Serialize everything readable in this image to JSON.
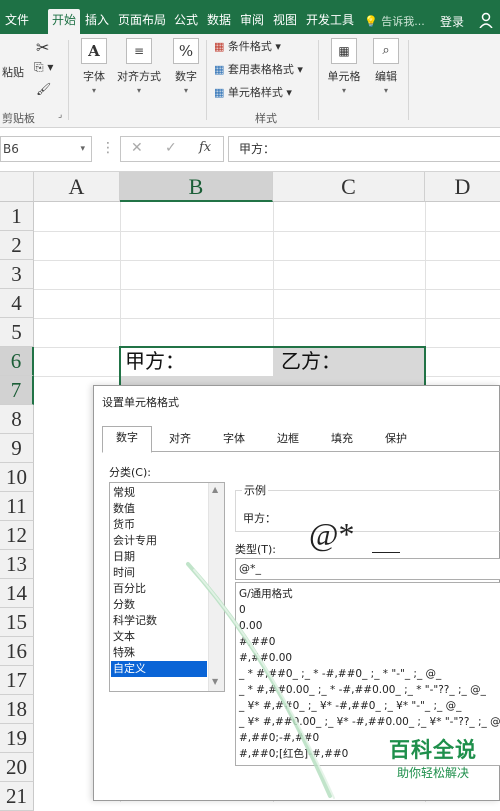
{
  "ribbon_tabs": [
    "文件",
    "开始",
    "插入",
    "页面布局",
    "公式",
    "数据",
    "审阅",
    "视图",
    "开发工具"
  ],
  "tellme": "告诉我...",
  "login": "登录",
  "clipboard": {
    "paste": "粘贴",
    "group": "剪贴板"
  },
  "ribbon_buttons": {
    "font": "字体",
    "align": "对齐方式",
    "number": "数字",
    "conditional": "条件格式",
    "table": "套用表格格式",
    "cellstyle": "单元格样式",
    "styles_group": "样式",
    "cells": "单元格",
    "editing": "编辑"
  },
  "formula_bar": {
    "namebox": "B6",
    "formula": "甲方："
  },
  "columns": [
    "A",
    "B",
    "C",
    "D"
  ],
  "rows": [
    "1",
    "2",
    "3",
    "4",
    "5",
    "6",
    "7",
    "8",
    "9",
    "10",
    "11",
    "12",
    "13",
    "14",
    "15",
    "16",
    "17",
    "18",
    "19",
    "20",
    "21"
  ],
  "cells": {
    "b6": "甲方：",
    "c6": "乙方："
  },
  "dialog": {
    "title": "设置单元格格式",
    "tabs": [
      "数字",
      "对齐",
      "字体",
      "边框",
      "填充",
      "保护"
    ],
    "category_label": "分类(C):",
    "categories": [
      "常规",
      "数值",
      "货币",
      "会计专用",
      "日期",
      "时间",
      "百分比",
      "分数",
      "科学记数",
      "文本",
      "特殊",
      "自定义"
    ],
    "selected_category": "自定义",
    "sample_label": "示例",
    "sample_value": "甲方：",
    "type_label": "类型(T):",
    "type_value": "@*_",
    "type_list": [
      "G/通用格式",
      "0",
      "0.00",
      "#,##0",
      "#,##0.00",
      "_ * #,##0_ ;_ * -#,##0_ ;_ * \"-\"_ ;_ @_",
      "_ * #,##0.00_ ;_ * -#,##0.00_ ;_ * \"-\"??_ ;_ @_",
      "_ ¥* #,##0_ ;_ ¥* -#,##0_ ;_ ¥* \"-\"_ ;_ @_",
      "_ ¥* #,##0.00_ ;_ ¥* -#,##0.00_ ;_ ¥* \"-\"??_ ;_ @_",
      "#,##0;-#,##0",
      "#,##0;[红色]-#,##0"
    ]
  },
  "overlay_big": "@*",
  "watermark": {
    "title": "百科全说",
    "subtitle": "助你轻松解决"
  }
}
